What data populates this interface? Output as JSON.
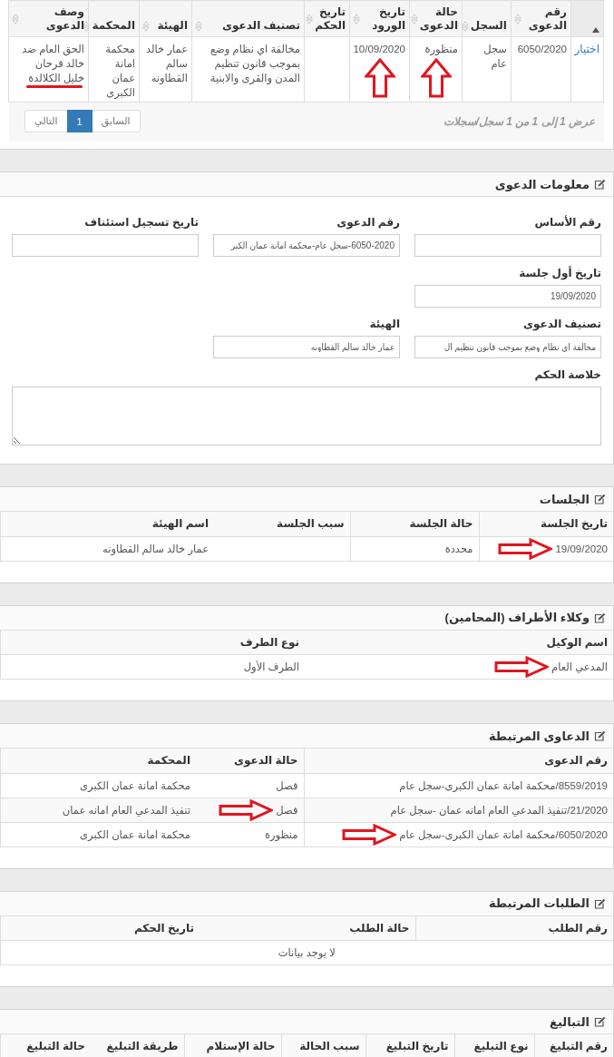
{
  "results": {
    "columns": [
      {
        "kind": "select",
        "sorted": true
      },
      {
        "kind": "data",
        "label": "رقم الدعوى",
        "sorted": false
      },
      {
        "kind": "data",
        "label": "السجل",
        "sorted": false
      },
      {
        "kind": "data",
        "label": "حالة الدعوى",
        "sorted": false
      },
      {
        "kind": "data",
        "label": "تاريخ الورود",
        "sorted": false
      },
      {
        "kind": "data",
        "label": "تاريخ الحكم",
        "sorted": false
      },
      {
        "kind": "data",
        "label": "تصنيف الدعوى",
        "sorted": false
      },
      {
        "kind": "data",
        "label": "الهيئة",
        "sorted": false
      },
      {
        "kind": "data",
        "label": "المحكمة",
        "sorted": false
      },
      {
        "kind": "data",
        "label": "وصف الدعوى",
        "sorted": false
      }
    ],
    "rows": [
      [
        {
          "kind": "link",
          "text": "اختيار"
        },
        {
          "kind": "text",
          "text": "6050/2020"
        },
        {
          "kind": "text",
          "text": "سجل عام"
        },
        {
          "kind": "arrow",
          "text": "منظورة"
        },
        {
          "kind": "arrow",
          "text": "10/09/2020"
        },
        null,
        {
          "kind": "text",
          "text": "مخالفة اي نظام وضع بموجب قانون تنظيم المدن والقرى والابنية"
        },
        {
          "kind": "text",
          "text": "عمار خالد سالم القطاونه"
        },
        {
          "kind": "text",
          "text": "محكمة امانة عمان الكبرى"
        },
        {
          "kind": "underlined",
          "text": "الحق العام ضد خالد فرحان خليل الكلالدة"
        }
      ]
    ],
    "info": "عرض 1 إلى 1 من 1 سجل/سجلات",
    "pages": [
      {
        "label": "السابق",
        "selected": false
      },
      {
        "label": "1",
        "selected": true
      },
      {
        "label": "التالي",
        "selected": false
      }
    ]
  },
  "case_info": {
    "title": "معلومات الدعوى",
    "rows": [
      [
        {
          "kind": "input",
          "label": "رقم الأساس"
        },
        {
          "kind": "input",
          "label": "رقم الدعوى",
          "value": "6050-2020-سجل عام-محكمة امانة عمان الكبر"
        },
        {
          "kind": "input",
          "label": "تاريخ تسجيل استئناف"
        }
      ],
      [
        {
          "kind": "input",
          "label": "تاريخ أول جلسة",
          "value": "19/09/2020"
        }
      ],
      [
        {
          "kind": "input",
          "label": "تصنيف الدعوى",
          "value": "مخالفة اي نظام وضع بموجب قانون تنظيم ال"
        },
        {
          "kind": "input",
          "label": "الهيئة",
          "value": "عمار خالد سالم القطاونه"
        }
      ],
      [
        {
          "kind": "textarea",
          "label": "خلاصة الحكم"
        }
      ]
    ]
  },
  "sections": [
    {
      "title": "الجلسات",
      "columns": [
        "تاريخ الجلسة",
        "حالة الجلسة",
        "سبب الجلسة",
        "اسم الهيئة"
      ],
      "rows": [
        [
          {
            "kind": "arrow",
            "text": "19/09/2020"
          },
          {
            "kind": "text",
            "text": "محددة"
          },
          null,
          {
            "kind": "text",
            "text": "عمار خالد سالم القطاونه"
          }
        ]
      ]
    },
    {
      "title": "وكلاء الأطراف (المحامين)",
      "columns": [
        "اسم الوكيل",
        "نوع الطرف"
      ],
      "rows": [
        [
          {
            "kind": "arrow",
            "text": "المدعي العام"
          },
          {
            "kind": "text",
            "text": "الطرف الأول"
          }
        ]
      ]
    },
    {
      "title": "الدعاوى المرتبطة",
      "columns": [
        "رقم الدعوى",
        "حالة الدعوى",
        "المحكمة"
      ],
      "rows": [
        [
          {
            "kind": "text",
            "text": "8559/2019/محكمة امانة عمان الكبرى-سجل عام"
          },
          {
            "kind": "text",
            "text": "فصل"
          },
          {
            "kind": "text",
            "text": "محكمة امانة عمان الكبرى"
          }
        ],
        [
          {
            "kind": "text",
            "text": "21/2020/تنفيذ المدعي العام امانه عمان -سجل عام"
          },
          {
            "kind": "arrow",
            "text": "فصل"
          },
          {
            "kind": "text",
            "text": "تنفيذ المدعي العام امانه عمان"
          }
        ],
        [
          {
            "kind": "arrow",
            "text": "6050/2020/محكمة امانة عمان الكبرى-سجل عام"
          },
          {
            "kind": "text",
            "text": "منظورة"
          },
          {
            "kind": "text",
            "text": "محكمة امانة عمان الكبرى"
          }
        ]
      ]
    },
    {
      "title": "الطلبات المرتبطة",
      "columns": [
        "رقم الطلب",
        "حالة الطلب",
        "تاريخ الحكم"
      ],
      "empty_message": "لا يوجد بيانات"
    },
    {
      "title": "التباليغ",
      "columns": [
        "رقم التبليغ",
        "نوع التبليغ",
        "تاريخ التبليغ",
        "سبب الحالة",
        "حالة الإستلام",
        "طريقة التبليغ",
        "حالة التبليغ"
      ]
    }
  ]
}
